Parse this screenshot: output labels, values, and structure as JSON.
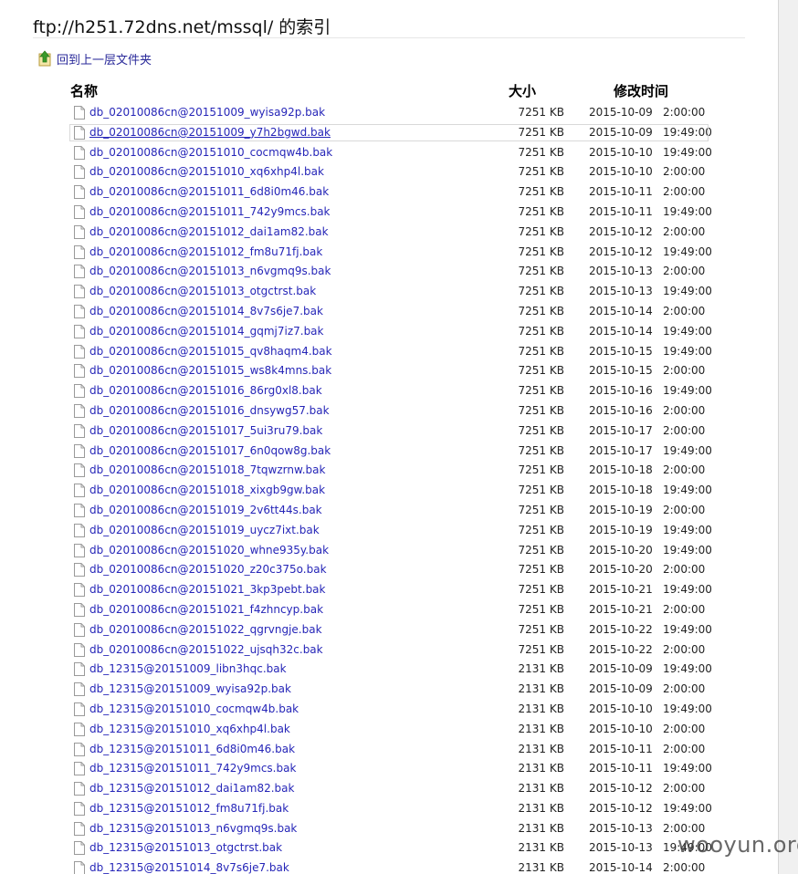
{
  "page": {
    "title": "ftp://h251.72dns.net/mssql/ 的索引",
    "up_link": "回到上一层文件夹"
  },
  "columns": {
    "name": "名称",
    "size": "大小",
    "modified": "修改时间"
  },
  "files": [
    {
      "name": "db_02010086cn@20151009_wyisa92p.bak",
      "size": "7251 KB",
      "date": "2015-10-09",
      "time": "2:00:00"
    },
    {
      "name": "db_02010086cn@20151009_y7h2bgwd.bak",
      "size": "7251 KB",
      "date": "2015-10-09",
      "time": "19:49:00"
    },
    {
      "name": "db_02010086cn@20151010_cocmqw4b.bak",
      "size": "7251 KB",
      "date": "2015-10-10",
      "time": "19:49:00"
    },
    {
      "name": "db_02010086cn@20151010_xq6xhp4l.bak",
      "size": "7251 KB",
      "date": "2015-10-10",
      "time": "2:00:00"
    },
    {
      "name": "db_02010086cn@20151011_6d8i0m46.bak",
      "size": "7251 KB",
      "date": "2015-10-11",
      "time": "2:00:00"
    },
    {
      "name": "db_02010086cn@20151011_742y9mcs.bak",
      "size": "7251 KB",
      "date": "2015-10-11",
      "time": "19:49:00"
    },
    {
      "name": "db_02010086cn@20151012_dai1am82.bak",
      "size": "7251 KB",
      "date": "2015-10-12",
      "time": "2:00:00"
    },
    {
      "name": "db_02010086cn@20151012_fm8u71fj.bak",
      "size": "7251 KB",
      "date": "2015-10-12",
      "time": "19:49:00"
    },
    {
      "name": "db_02010086cn@20151013_n6vgmq9s.bak",
      "size": "7251 KB",
      "date": "2015-10-13",
      "time": "2:00:00"
    },
    {
      "name": "db_02010086cn@20151013_otgctrst.bak",
      "size": "7251 KB",
      "date": "2015-10-13",
      "time": "19:49:00"
    },
    {
      "name": "db_02010086cn@20151014_8v7s6je7.bak",
      "size": "7251 KB",
      "date": "2015-10-14",
      "time": "2:00:00"
    },
    {
      "name": "db_02010086cn@20151014_gqmj7iz7.bak",
      "size": "7251 KB",
      "date": "2015-10-14",
      "time": "19:49:00"
    },
    {
      "name": "db_02010086cn@20151015_qv8haqm4.bak",
      "size": "7251 KB",
      "date": "2015-10-15",
      "time": "19:49:00"
    },
    {
      "name": "db_02010086cn@20151015_ws8k4mns.bak",
      "size": "7251 KB",
      "date": "2015-10-15",
      "time": "2:00:00"
    },
    {
      "name": "db_02010086cn@20151016_86rg0xl8.bak",
      "size": "7251 KB",
      "date": "2015-10-16",
      "time": "19:49:00"
    },
    {
      "name": "db_02010086cn@20151016_dnsywg57.bak",
      "size": "7251 KB",
      "date": "2015-10-16",
      "time": "2:00:00"
    },
    {
      "name": "db_02010086cn@20151017_5ui3ru79.bak",
      "size": "7251 KB",
      "date": "2015-10-17",
      "time": "2:00:00"
    },
    {
      "name": "db_02010086cn@20151017_6n0qow8g.bak",
      "size": "7251 KB",
      "date": "2015-10-17",
      "time": "19:49:00"
    },
    {
      "name": "db_02010086cn@20151018_7tqwzrnw.bak",
      "size": "7251 KB",
      "date": "2015-10-18",
      "time": "2:00:00"
    },
    {
      "name": "db_02010086cn@20151018_xixgb9gw.bak",
      "size": "7251 KB",
      "date": "2015-10-18",
      "time": "19:49:00"
    },
    {
      "name": "db_02010086cn@20151019_2v6tt44s.bak",
      "size": "7251 KB",
      "date": "2015-10-19",
      "time": "2:00:00"
    },
    {
      "name": "db_02010086cn@20151019_uycz7ixt.bak",
      "size": "7251 KB",
      "date": "2015-10-19",
      "time": "19:49:00"
    },
    {
      "name": "db_02010086cn@20151020_whne935y.bak",
      "size": "7251 KB",
      "date": "2015-10-20",
      "time": "19:49:00"
    },
    {
      "name": "db_02010086cn@20151020_z20c375o.bak",
      "size": "7251 KB",
      "date": "2015-10-20",
      "time": "2:00:00"
    },
    {
      "name": "db_02010086cn@20151021_3kp3pebt.bak",
      "size": "7251 KB",
      "date": "2015-10-21",
      "time": "19:49:00"
    },
    {
      "name": "db_02010086cn@20151021_f4zhncyp.bak",
      "size": "7251 KB",
      "date": "2015-10-21",
      "time": "2:00:00"
    },
    {
      "name": "db_02010086cn@20151022_qgrvngje.bak",
      "size": "7251 KB",
      "date": "2015-10-22",
      "time": "19:49:00"
    },
    {
      "name": "db_02010086cn@20151022_ujsqh32c.bak",
      "size": "7251 KB",
      "date": "2015-10-22",
      "time": "2:00:00"
    },
    {
      "name": "db_12315@20151009_libn3hqc.bak",
      "size": "2131 KB",
      "date": "2015-10-09",
      "time": "19:49:00"
    },
    {
      "name": "db_12315@20151009_wyisa92p.bak",
      "size": "2131 KB",
      "date": "2015-10-09",
      "time": "2:00:00"
    },
    {
      "name": "db_12315@20151010_cocmqw4b.bak",
      "size": "2131 KB",
      "date": "2015-10-10",
      "time": "19:49:00"
    },
    {
      "name": "db_12315@20151010_xq6xhp4l.bak",
      "size": "2131 KB",
      "date": "2015-10-10",
      "time": "2:00:00"
    },
    {
      "name": "db_12315@20151011_6d8i0m46.bak",
      "size": "2131 KB",
      "date": "2015-10-11",
      "time": "2:00:00"
    },
    {
      "name": "db_12315@20151011_742y9mcs.bak",
      "size": "2131 KB",
      "date": "2015-10-11",
      "time": "19:49:00"
    },
    {
      "name": "db_12315@20151012_dai1am82.bak",
      "size": "2131 KB",
      "date": "2015-10-12",
      "time": "2:00:00"
    },
    {
      "name": "db_12315@20151012_fm8u71fj.bak",
      "size": "2131 KB",
      "date": "2015-10-12",
      "time": "19:49:00"
    },
    {
      "name": "db_12315@20151013_n6vgmq9s.bak",
      "size": "2131 KB",
      "date": "2015-10-13",
      "time": "2:00:00"
    },
    {
      "name": "db_12315@20151013_otgctrst.bak",
      "size": "2131 KB",
      "date": "2015-10-13",
      "time": "19:49:00"
    },
    {
      "name": "db_12315@20151014_8v7s6je7.bak",
      "size": "2131 KB",
      "date": "2015-10-14",
      "time": "2:00:00"
    }
  ],
  "focused_row": 1,
  "icons": {
    "up": "folder-up-icon",
    "file": "file-icon"
  },
  "watermark": "wooyun.org",
  "colors": {
    "link": "#2626b8",
    "text": "#222222",
    "up_arrow": "#3a9a2a"
  }
}
